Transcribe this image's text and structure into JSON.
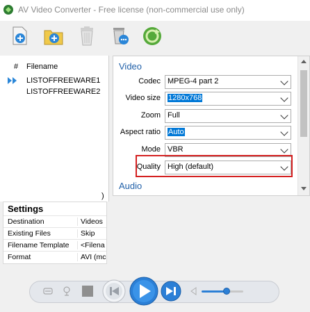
{
  "window": {
    "title": "AV Video Converter - Free license (non-commercial use only)"
  },
  "toolbar": {
    "buttons": [
      {
        "icon": "add-file-icon"
      },
      {
        "icon": "add-folder-icon"
      },
      {
        "icon": "trash-icon"
      },
      {
        "icon": "delete-options-icon"
      },
      {
        "icon": "convert-icon"
      }
    ]
  },
  "file_list": {
    "col_index": "#",
    "col_filename": "Filename",
    "files": [
      "LISTOFFREEWARE1",
      "LISTOFFREEWARE2"
    ],
    "scroll_glyph": ")"
  },
  "settings": {
    "title": "Settings",
    "rows": [
      {
        "label": "Destination",
        "value": "Videos"
      },
      {
        "label": "Existing Files",
        "value": "Skip"
      },
      {
        "label": "Filename Template",
        "value": "<Filena"
      },
      {
        "label": "Format",
        "value": "AVI (mc"
      }
    ]
  },
  "video": {
    "section_title": "Video",
    "props": [
      {
        "label": "Codec",
        "value": "MPEG-4 part 2",
        "selected": false
      },
      {
        "label": "Video size",
        "value": "1280x768",
        "selected": true
      },
      {
        "label": "Zoom",
        "value": "Full",
        "selected": false
      },
      {
        "label": "Aspect ratio",
        "value": "Auto",
        "selected": true
      },
      {
        "label": "Mode",
        "value": "VBR",
        "selected": false
      },
      {
        "label": "Quality",
        "value": "High (default)",
        "selected": false
      }
    ]
  },
  "audio": {
    "section_title": "Audio"
  },
  "player": {
    "volume": 0.6,
    "accent": "#2b7fd6"
  }
}
